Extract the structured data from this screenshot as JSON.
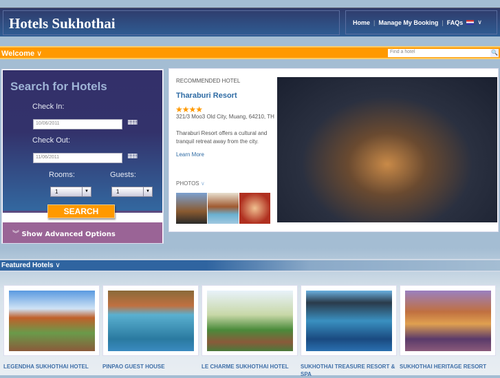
{
  "header": {
    "title": "Hotels Sukhothai",
    "nav": [
      "Home",
      "Manage My Booking",
      "FAQs"
    ],
    "language_icon": "us-flag-icon"
  },
  "welcome_bar": {
    "label": "Welcome",
    "search_placeholder": "Find a hotel"
  },
  "search_panel": {
    "title": "Search for Hotels",
    "check_in_label": "Check In:",
    "check_in_value": "10/06/2011",
    "check_out_label": "Check Out:",
    "check_out_value": "11/06/2011",
    "rooms_label": "Rooms:",
    "rooms_value": "1",
    "guests_label": "Guests:",
    "guests_value": "1",
    "search_button": "SEARCH",
    "advanced": "Show Advanced Options"
  },
  "recommended": {
    "label": "RECOMMENDED HOTEL",
    "name": "Tharaburi Resort",
    "stars": 4,
    "stars_text": "★★★★",
    "address": "321/3 Moo3 Old City, Muang, 64210, TH",
    "description": "Tharaburi Resort offers a cultural and tranquil retreat away from the city.",
    "learn_more": "Learn More",
    "photos_label": "PHOTOS"
  },
  "featured": {
    "title": "Featured Hotels",
    "hotels": [
      "LEGENDHA SUKHOTHAI HOTEL",
      "PINPAO GUEST HOUSE",
      "LE CHARME SUKHOTHAI HOTEL",
      "SUKHOTHAI TREASURE RESORT & SPA",
      "SUKHOTHAI HERITAGE RESORT"
    ]
  },
  "colors": {
    "accent": "#ff9900",
    "header": "#2f3a6a",
    "link": "#2e6ba4",
    "advanced": "#9a6496"
  }
}
